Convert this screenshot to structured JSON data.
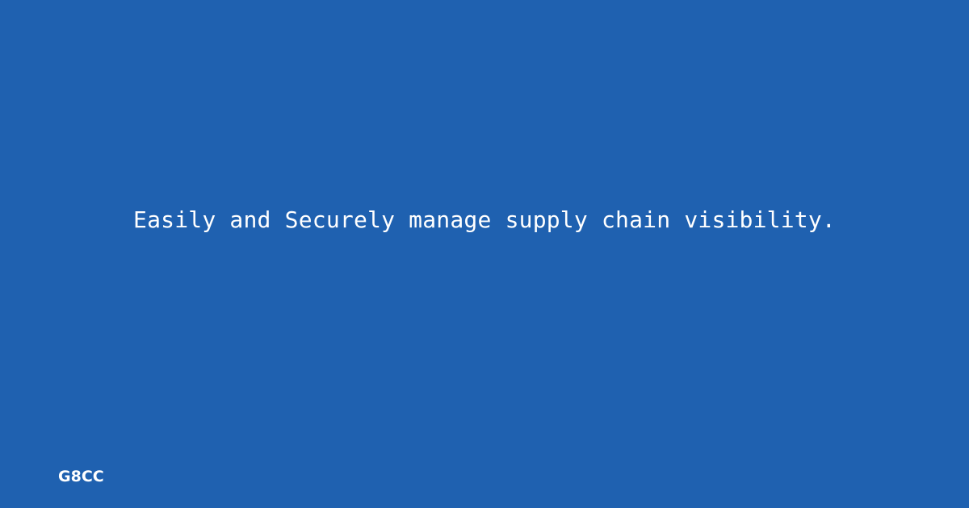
{
  "card": {
    "background_color": "#1f61b0",
    "text_color": "#ffffff",
    "tagline": "Easily and Securely manage supply chain visibility.",
    "brand": "G8CC"
  }
}
